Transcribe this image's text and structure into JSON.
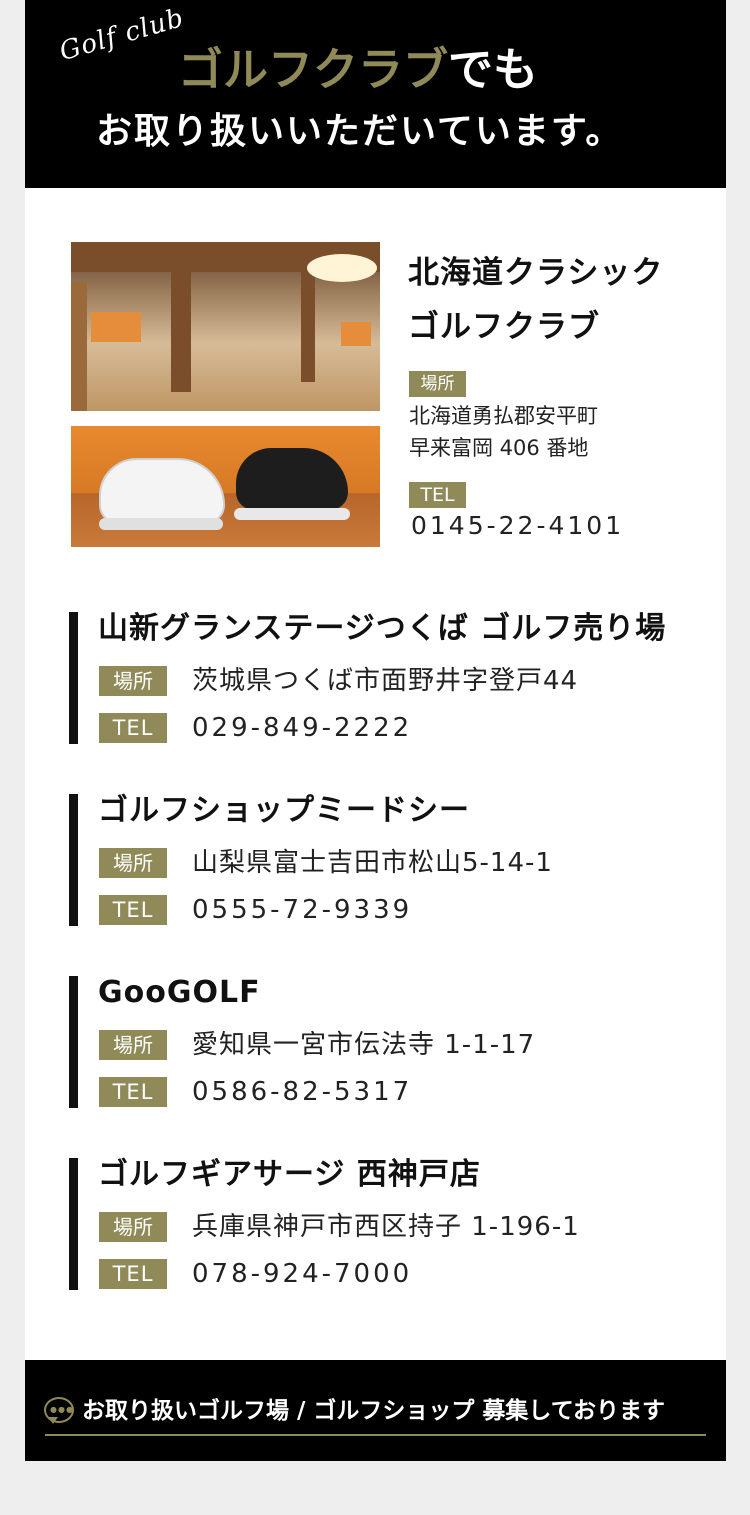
{
  "header": {
    "script": "Golf club",
    "line1_gold": "ゴルフクラブ",
    "line1_white": "でも",
    "line2": "お取り扱いいただいています。"
  },
  "featured": {
    "name_line1": "北海道クラシック",
    "name_line2": "ゴルフクラブ",
    "place_label": "場所",
    "address_line1": "北海道勇払郡安平町",
    "address_line2": "早来富岡 406 番地",
    "tel_label": "TEL",
    "tel": "0145-22-4101"
  },
  "stores": [
    {
      "name": "山新グランステージつくば ゴルフ売り場",
      "place_label": "場所",
      "address": "茨城県つくば市面野井字登戸44",
      "tel_label": "TEL",
      "tel": "029-849-2222"
    },
    {
      "name": "ゴルフショップミードシー",
      "place_label": "場所",
      "address": "山梨県富士吉田市松山5-14-1",
      "tel_label": "TEL",
      "tel": "0555-72-9339"
    },
    {
      "name": "GooGOLF",
      "place_label": "場所",
      "address": "愛知県一宮市伝法寺 1-1-17",
      "tel_label": "TEL",
      "tel": "0586-82-5317"
    },
    {
      "name": "ゴルフギアサージ 西神戸店",
      "place_label": "場所",
      "address": "兵庫県神戸市西区持子 1-196-1",
      "tel_label": "TEL",
      "tel": "078-924-7000"
    }
  ],
  "footer": {
    "text": "お取り扱いゴルフ場 / ゴルフショップ 募集しております"
  },
  "colors": {
    "accent": "#8f8a58",
    "header_bg": "#000000"
  }
}
